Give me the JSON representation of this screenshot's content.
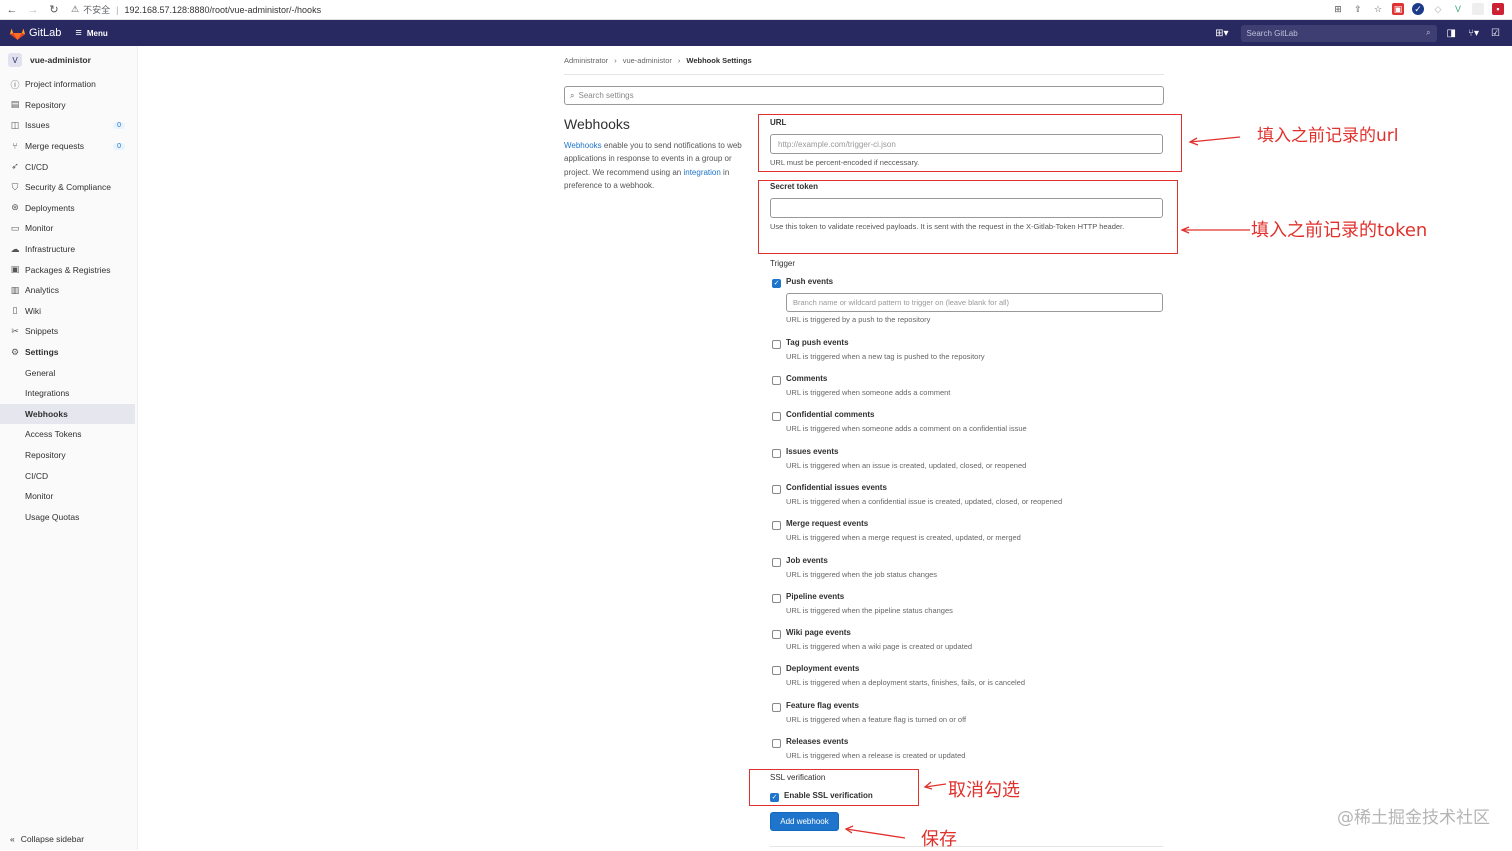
{
  "browser": {
    "insecure_label": "不安全",
    "url": "192.168.57.128:8880/root/vue-administor/-/hooks"
  },
  "header": {
    "logo_text": "GitLab",
    "menu_label": "Menu",
    "search_placeholder": "Search GitLab"
  },
  "sidebar": {
    "project_initial": "V",
    "project_name": "vue-administor",
    "items": [
      {
        "label": "Project information",
        "icon": "info-icon"
      },
      {
        "label": "Repository",
        "icon": "doc-icon"
      },
      {
        "label": "Issues",
        "icon": "issues-icon",
        "badge": "0"
      },
      {
        "label": "Merge requests",
        "icon": "merge-icon",
        "badge": "0"
      },
      {
        "label": "CI/CD",
        "icon": "rocket-icon"
      },
      {
        "label": "Security & Compliance",
        "icon": "shield-icon"
      },
      {
        "label": "Deployments",
        "icon": "deploy-icon"
      },
      {
        "label": "Monitor",
        "icon": "monitor-icon"
      },
      {
        "label": "Infrastructure",
        "icon": "cloud-icon"
      },
      {
        "label": "Packages & Registries",
        "icon": "package-icon"
      },
      {
        "label": "Analytics",
        "icon": "chart-icon"
      },
      {
        "label": "Wiki",
        "icon": "book-icon"
      },
      {
        "label": "Snippets",
        "icon": "scissors-icon"
      },
      {
        "label": "Settings",
        "icon": "gear-icon"
      }
    ],
    "sub_items": [
      "General",
      "Integrations",
      "Webhooks",
      "Access Tokens",
      "Repository",
      "CI/CD",
      "Monitor",
      "Usage Quotas"
    ],
    "collapse_label": "Collapse sidebar"
  },
  "breadcrumb": [
    "Administrator",
    "vue-administor",
    "Webhook Settings"
  ],
  "search_settings_placeholder": "Search settings",
  "webhooks": {
    "title": "Webhooks",
    "desc_link1": "Webhooks",
    "desc_part1": " enable you to send notifications to web applications in response to events in a group or project. We recommend using an ",
    "desc_link2": "integration",
    "desc_part2": " in preference to a webhook."
  },
  "form": {
    "url_label": "URL",
    "url_placeholder": "http://example.com/trigger-ci.json",
    "url_hint": "URL must be percent-encoded if neccessary.",
    "token_label": "Secret token",
    "token_hint": "Use this token to validate received payloads. It is sent with the request in the X-Gitlab-Token HTTP header.",
    "trigger_label": "Trigger",
    "branch_placeholder": "Branch name or wildcard pattern to trigger on (leave blank for all)",
    "events": [
      {
        "name": "Push events",
        "desc": "URL is triggered by a push to the repository",
        "checked": true
      },
      {
        "name": "Tag push events",
        "desc": "URL is triggered when a new tag is pushed to the repository",
        "checked": false
      },
      {
        "name": "Comments",
        "desc": "URL is triggered when someone adds a comment",
        "checked": false
      },
      {
        "name": "Confidential comments",
        "desc": "URL is triggered when someone adds a comment on a confidential issue",
        "checked": false
      },
      {
        "name": "Issues events",
        "desc": "URL is triggered when an issue is created, updated, closed, or reopened",
        "checked": false
      },
      {
        "name": "Confidential issues events",
        "desc": "URL is triggered when a confidential issue is created, updated, closed, or reopened",
        "checked": false
      },
      {
        "name": "Merge request events",
        "desc": "URL is triggered when a merge request is created, updated, or merged",
        "checked": false
      },
      {
        "name": "Job events",
        "desc": "URL is triggered when the job status changes",
        "checked": false
      },
      {
        "name": "Pipeline events",
        "desc": "URL is triggered when the pipeline status changes",
        "checked": false
      },
      {
        "name": "Wiki page events",
        "desc": "URL is triggered when a wiki page is created or updated",
        "checked": false
      },
      {
        "name": "Deployment events",
        "desc": "URL is triggered when a deployment starts, finishes, fails, or is canceled",
        "checked": false
      },
      {
        "name": "Feature flag events",
        "desc": "URL is triggered when a feature flag is turned on or off",
        "checked": false
      },
      {
        "name": "Releases events",
        "desc": "URL is triggered when a release is created or updated",
        "checked": false
      }
    ],
    "ssl_label": "SSL verification",
    "ssl_checkbox_label": "Enable SSL verification",
    "ssl_checked": true,
    "submit_label": "Add webhook"
  },
  "annotations": {
    "url_note": "填入之前记录的url",
    "token_note": "填入之前记录的token",
    "ssl_note": "取消勾选",
    "save_note": "保存",
    "watermark": "@稀土掘金技术社区",
    "color": "#e0312c"
  }
}
